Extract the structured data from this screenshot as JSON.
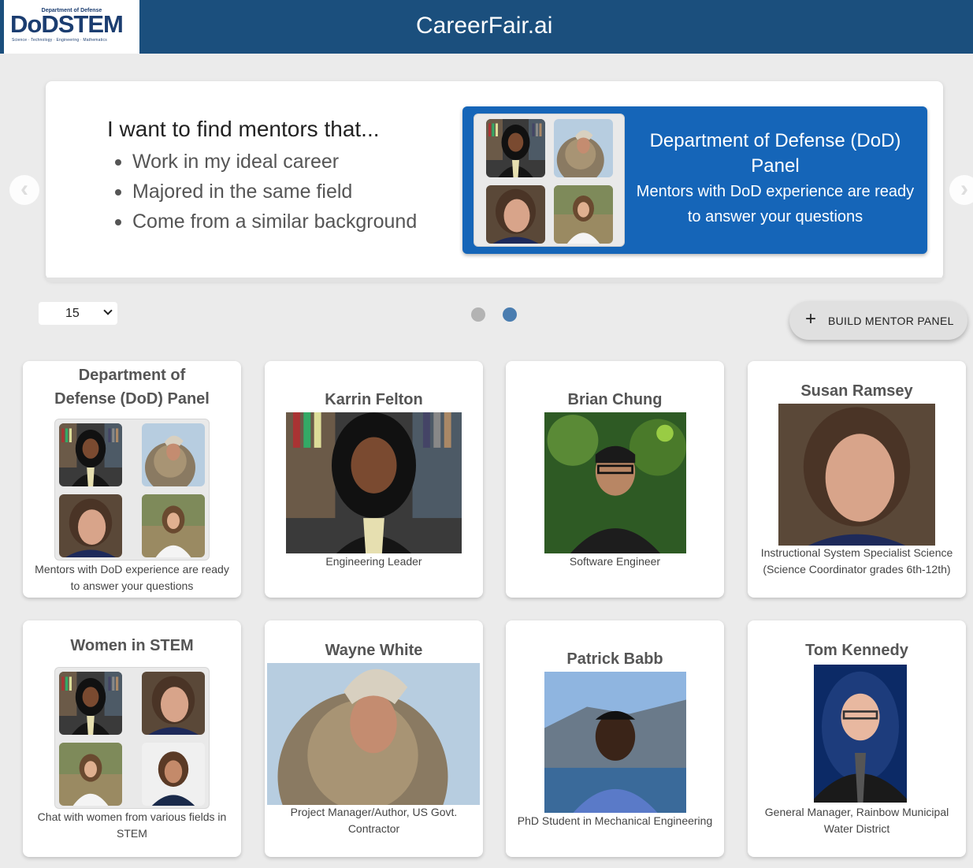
{
  "header": {
    "logo_dept": "Department of Defense",
    "logo_do": "DoD",
    "logo_stem": "STEM",
    "logo_sub": "Science · Technology · Engineering · Mathematics",
    "title": "CareerFair.ai"
  },
  "carousel": {
    "heading": "I want to find mentors that...",
    "bullets": [
      "Work in my ideal career",
      "Majored in the same field",
      "Come from a similar background"
    ],
    "promo_title": "Department of Defense (DoD) Panel",
    "promo_subtitle": "Mentors with DoD experience are ready to answer your questions",
    "prev_icon": "chevron-left-icon",
    "next_icon": "chevron-right-icon",
    "dots_active_index": 1
  },
  "controls": {
    "page_size": "15",
    "build_button": "BUILD MENTOR PANEL"
  },
  "colors": {
    "header_bg": "#1b4f7d",
    "promo_bg": "#1565b8",
    "dot_active": "#4a7db0",
    "dot_inactive": "#b3b3b3"
  },
  "cards": [
    {
      "title": "Department of Defense (DoD) Panel",
      "description": "Mentors with DoD experience are ready to answer your questions",
      "kind": "panel"
    },
    {
      "title": "Karrin Felton",
      "description": "Engineering Leader",
      "kind": "mentor"
    },
    {
      "title": "Brian Chung",
      "description": "Software Engineer",
      "kind": "mentor"
    },
    {
      "title": "Susan Ramsey",
      "description": "Instructional System Specialist Science (Science Coordinator grades 6th-12th)",
      "kind": "mentor"
    },
    {
      "title": "Women in STEM",
      "description": "Chat with women from various fields in STEM",
      "kind": "panel"
    },
    {
      "title": "Wayne White",
      "description": "Project Manager/Author, US Govt. Contractor",
      "kind": "mentor"
    },
    {
      "title": "Patrick Babb",
      "description": "PhD Student in Mechanical Engineering",
      "kind": "mentor"
    },
    {
      "title": "Tom Kennedy",
      "description": "General Manager, Rainbow Municipal Water District",
      "kind": "mentor"
    }
  ]
}
